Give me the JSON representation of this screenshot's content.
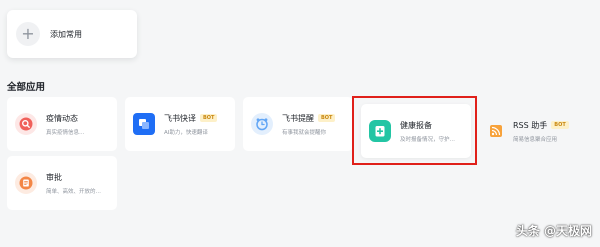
{
  "common": {
    "add_label": "添加常用"
  },
  "section": {
    "title": "全部应用"
  },
  "apps": [
    {
      "name": "疫情动态",
      "desc": "真实疫情信息…",
      "icon": "search-magnifier-icon",
      "color": "#f0605a",
      "bot": ""
    },
    {
      "name": "飞书快译",
      "desc": "AI助力，快速翻译",
      "icon": "translate-icon",
      "color": "#1f6ef5",
      "bot": "BOT"
    },
    {
      "name": "飞书提醒",
      "desc": "有事我就会提醒你",
      "icon": "alarm-clock-icon",
      "color": "#62a6f5",
      "bot": "BOT"
    },
    {
      "name": "健康报备",
      "desc": "及时报备情况，守护…",
      "icon": "health-report-icon",
      "color": "#23c5a4",
      "bot": ""
    },
    {
      "name": "RSS 助手",
      "desc": "简易信息聚合应用",
      "icon": "rss-icon",
      "color": "#f7a23b",
      "bot": "BOT"
    },
    {
      "name": "审批",
      "desc": "简单、高效、开放的…",
      "icon": "approval-document-icon",
      "color": "#f38646",
      "bot": ""
    }
  ],
  "watermark": "头条 @天极网"
}
